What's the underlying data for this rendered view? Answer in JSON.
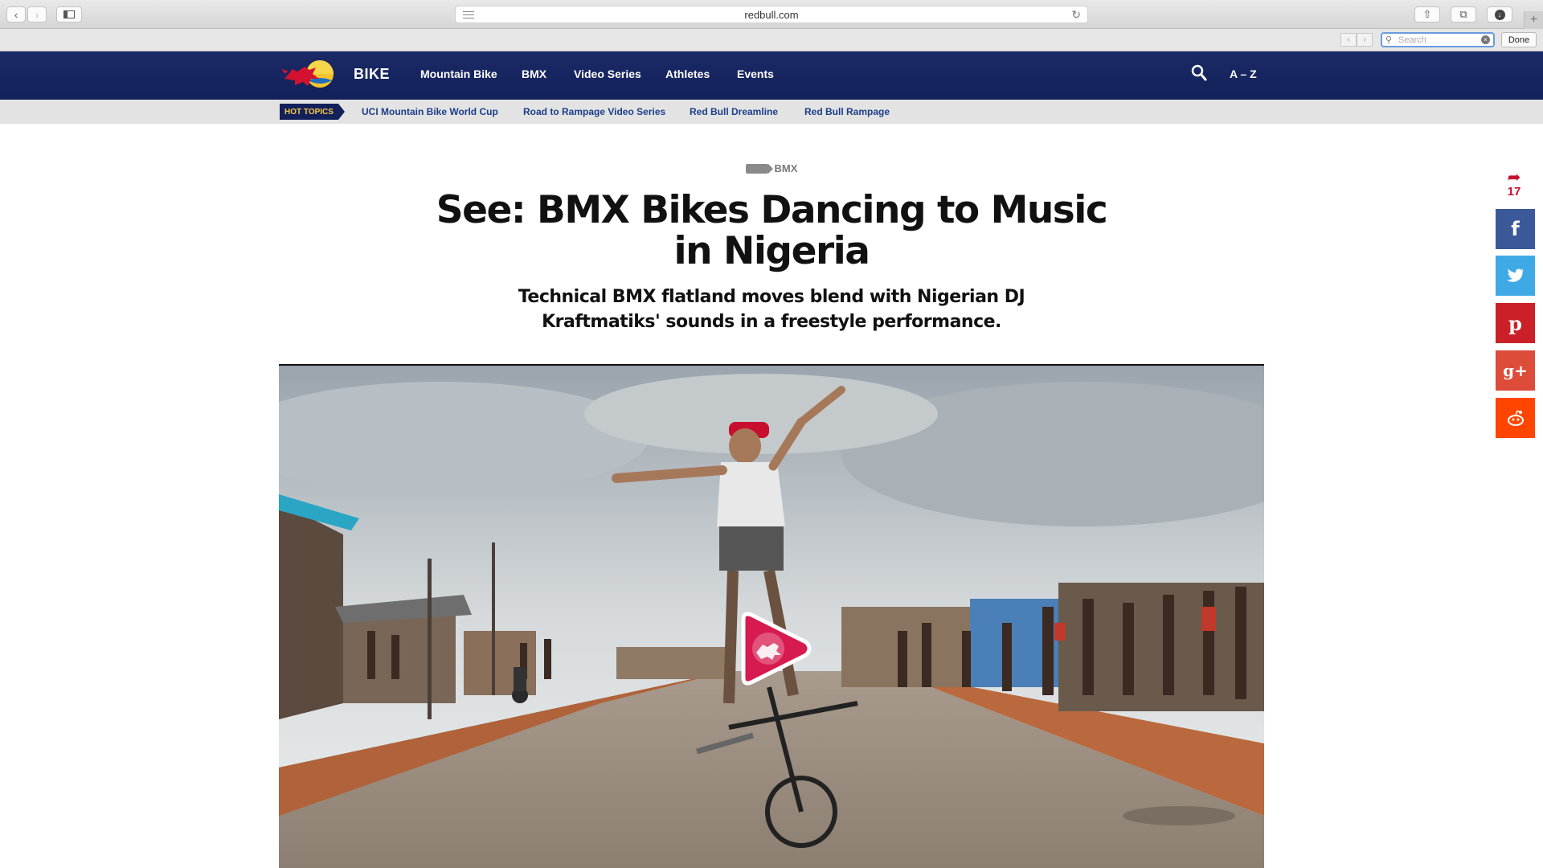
{
  "browser": {
    "url": "redbull.com",
    "find_placeholder": "Search",
    "done_label": "Done"
  },
  "site": {
    "brand": "BIKE",
    "nav": [
      "Mountain Bike",
      "BMX",
      "Video Series",
      "Athletes",
      "Events"
    ],
    "az_label": "A – Z",
    "hot_topics_label": "HOT TOPICS",
    "topics": [
      "UCI Mountain Bike World Cup",
      "Road to Rampage Video Series",
      "Red Bull Dreamline",
      "Red Bull Rampage"
    ]
  },
  "article": {
    "category": "BMX",
    "headline": "See: BMX Bikes Dancing to Music in Nigeria",
    "subheadline": "Technical BMX flatland moves blend with Nigerian DJ Kraftmatiks' sounds in a freestyle performance."
  },
  "share": {
    "count": "17",
    "buttons": [
      {
        "name": "facebook",
        "glyph": "f",
        "color": "#3b5998"
      },
      {
        "name": "twitter",
        "glyph": "🐦",
        "color": "#3fa9e6"
      },
      {
        "name": "pinterest",
        "glyph": "p",
        "color": "#cb2027"
      },
      {
        "name": "google-plus",
        "glyph": "g+",
        "color": "#dd4b39"
      },
      {
        "name": "reddit",
        "glyph": "👽",
        "color": "#ff4500"
      }
    ]
  },
  "colors": {
    "nav_bg": "#13215a",
    "accent": "#c8102e",
    "topic_link": "#1c3e8a"
  }
}
